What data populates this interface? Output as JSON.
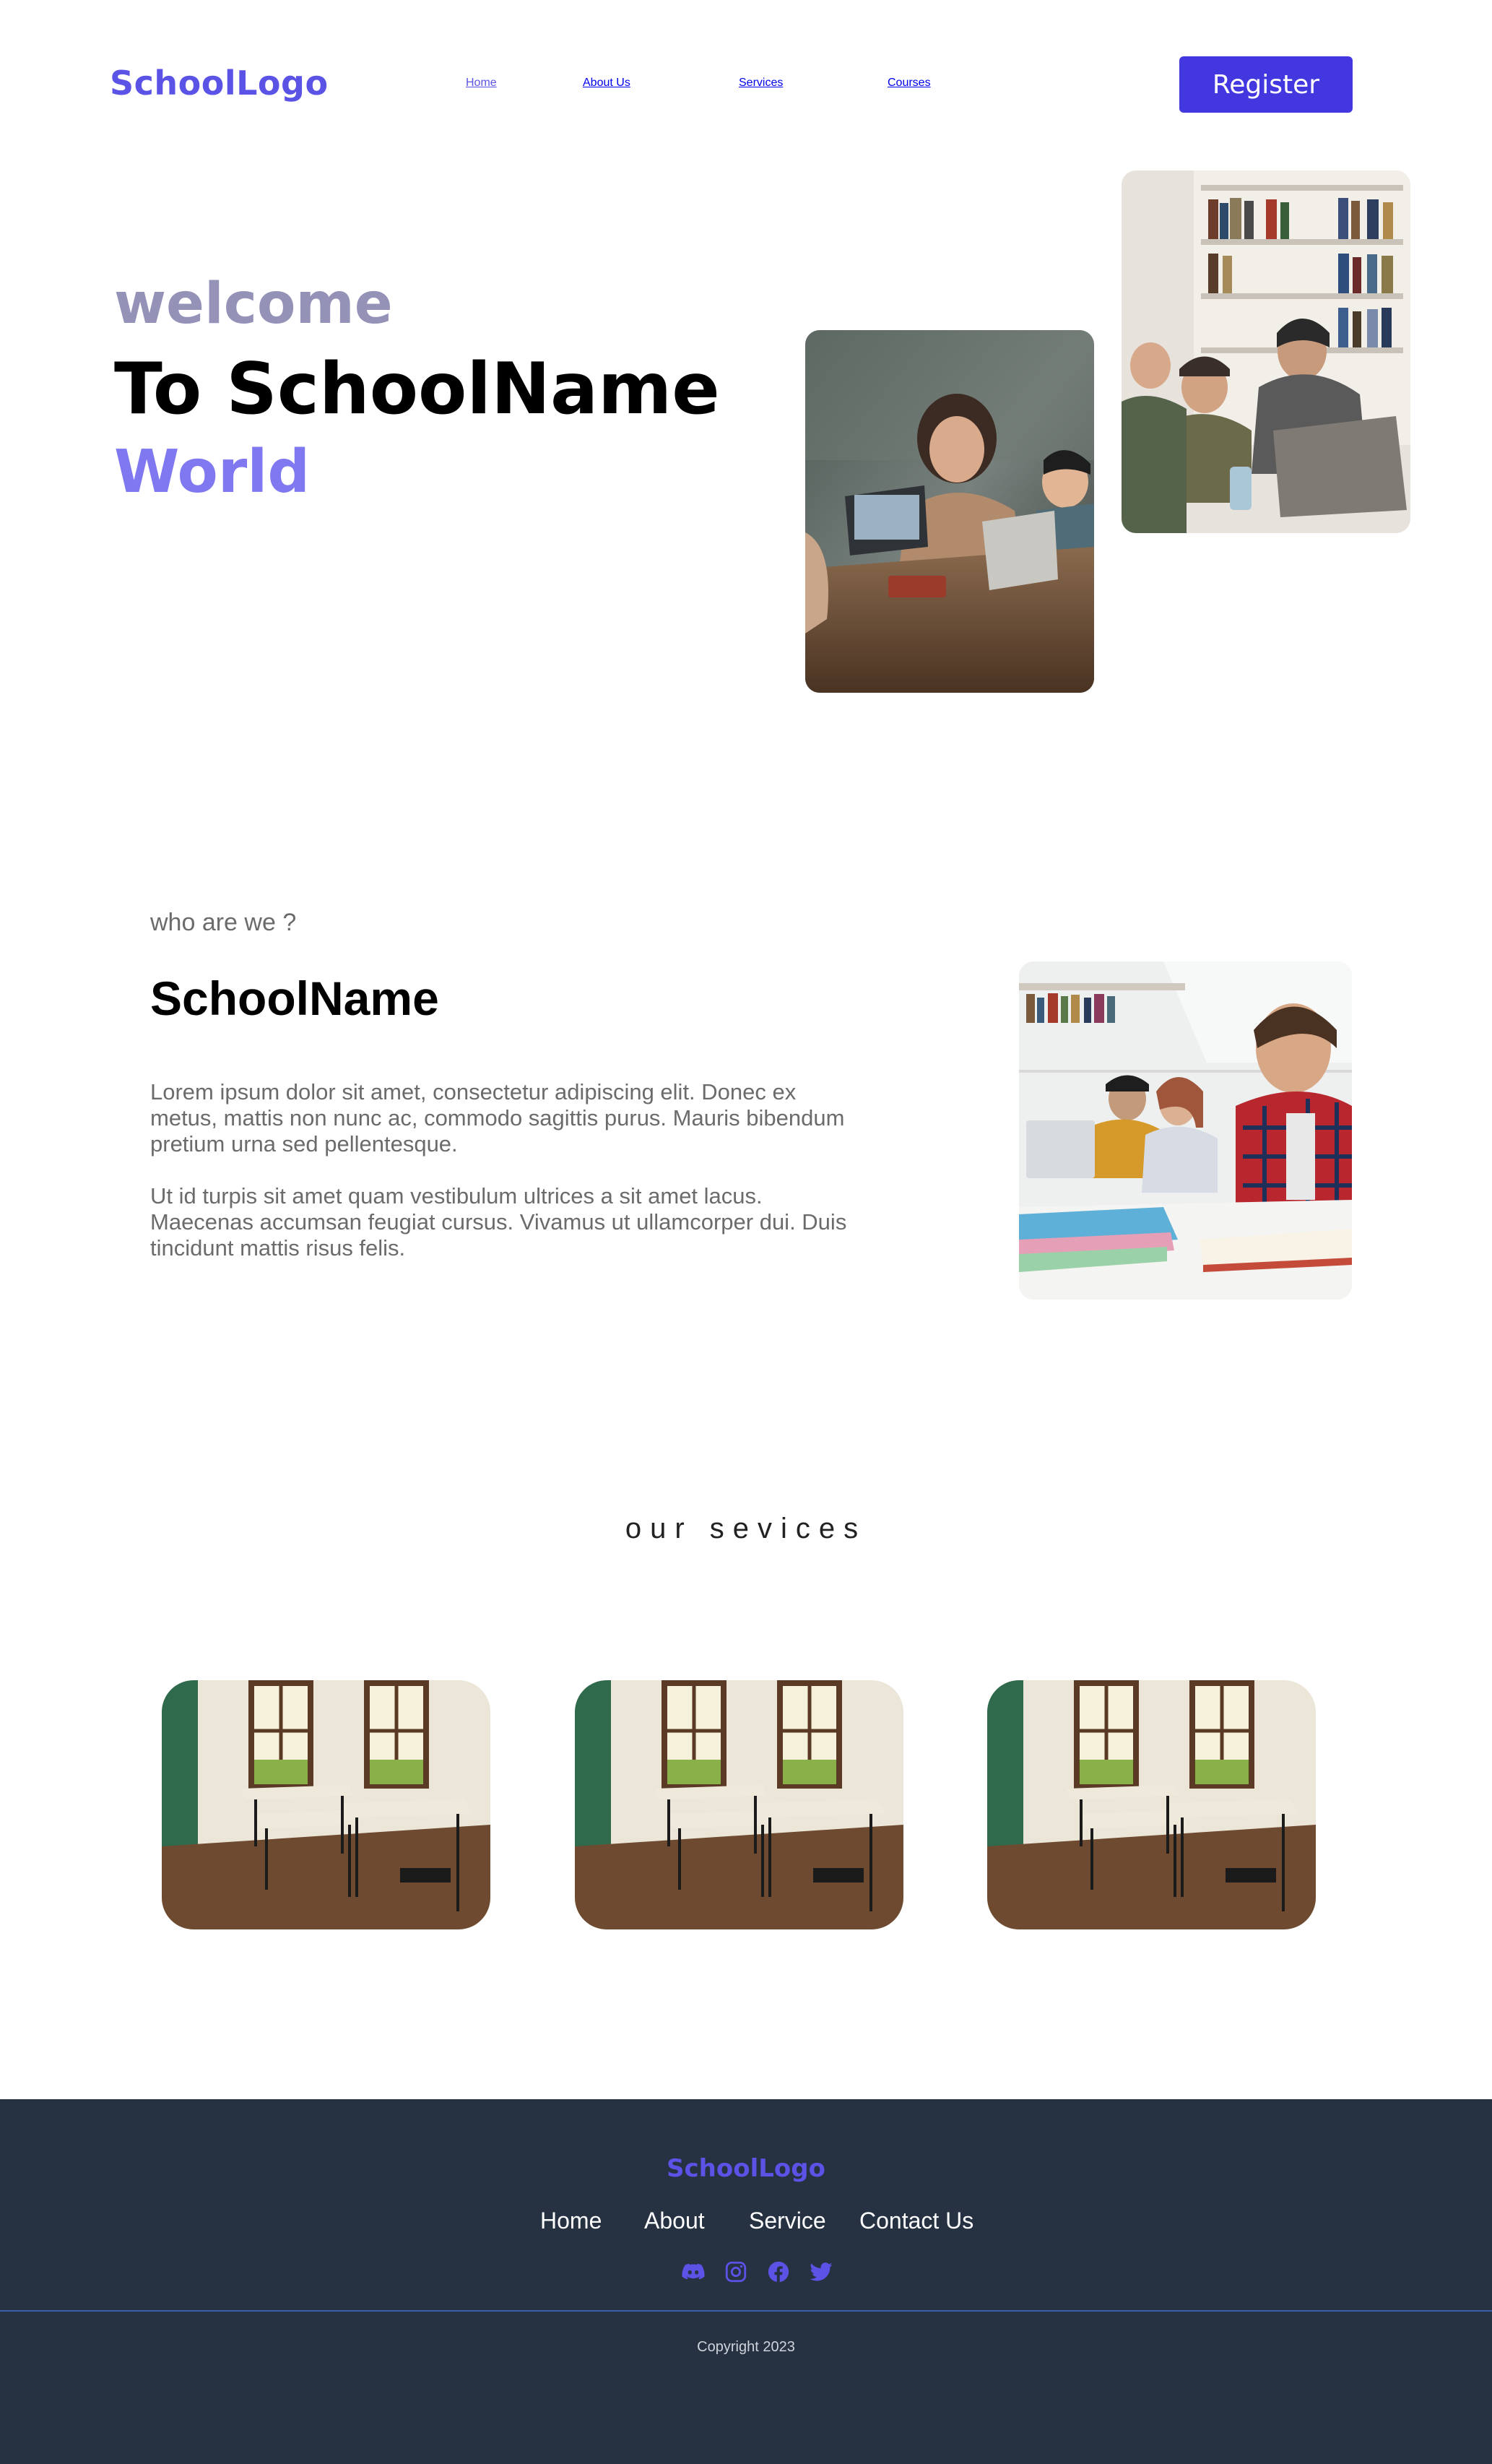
{
  "nav": {
    "logo": "SchoolLogo",
    "links": [
      "Home",
      "About Us",
      "Services",
      "Courses"
    ],
    "active": "Home",
    "register_label": "Register"
  },
  "hero": {
    "line1": "welcome",
    "line2": "To SchoolName",
    "line3": "World"
  },
  "about": {
    "eyebrow": "who are we ?",
    "title": "SchoolName",
    "paragraphs": [
      "Lorem ipsum dolor sit amet, consectetur adipiscing elit. Donec ex metus, mattis non nunc ac, commodo sagittis purus. Mauris bibendum pretium urna sed pellentesque.",
      "Ut id turpis sit amet quam vestibulum ultrices a sit amet lacus. Maecenas accumsan feugiat cursus. Vivamus ut ullamcorper dui. Duis tincidunt mattis risus felis."
    ]
  },
  "services": {
    "title": "our sevices"
  },
  "footer": {
    "logo": "SchoolLogo",
    "links": [
      "Home",
      "About",
      "Service",
      "Contact Us"
    ],
    "social_icons": [
      "discord-icon",
      "instagram-icon",
      "facebook-icon",
      "twitter-icon"
    ],
    "copyright": "Copyright 2023"
  },
  "colors": {
    "brand": "#5b53e6",
    "button": "#4338e0",
    "footer_bg": "#263142"
  }
}
